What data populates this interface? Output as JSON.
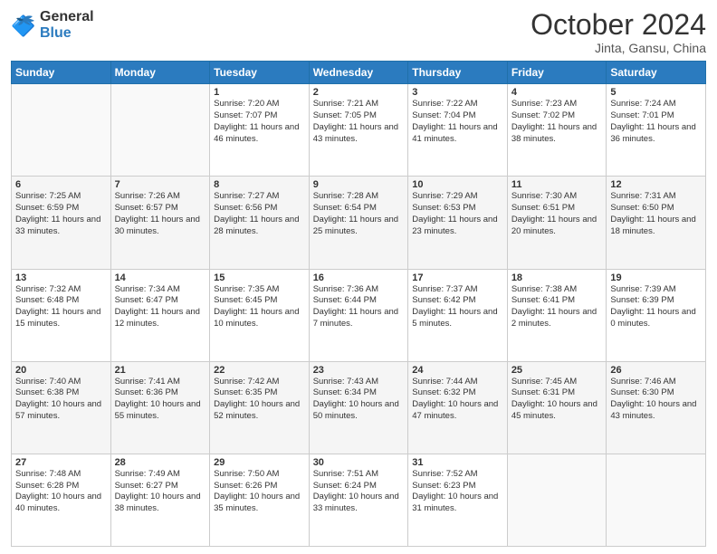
{
  "header": {
    "logo_line1": "General",
    "logo_line2": "Blue",
    "month": "October 2024",
    "location": "Jinta, Gansu, China"
  },
  "weekdays": [
    "Sunday",
    "Monday",
    "Tuesday",
    "Wednesday",
    "Thursday",
    "Friday",
    "Saturday"
  ],
  "weeks": [
    [
      {
        "day": "",
        "info": ""
      },
      {
        "day": "",
        "info": ""
      },
      {
        "day": "1",
        "info": "Sunrise: 7:20 AM\nSunset: 7:07 PM\nDaylight: 11 hours and 46 minutes."
      },
      {
        "day": "2",
        "info": "Sunrise: 7:21 AM\nSunset: 7:05 PM\nDaylight: 11 hours and 43 minutes."
      },
      {
        "day": "3",
        "info": "Sunrise: 7:22 AM\nSunset: 7:04 PM\nDaylight: 11 hours and 41 minutes."
      },
      {
        "day": "4",
        "info": "Sunrise: 7:23 AM\nSunset: 7:02 PM\nDaylight: 11 hours and 38 minutes."
      },
      {
        "day": "5",
        "info": "Sunrise: 7:24 AM\nSunset: 7:01 PM\nDaylight: 11 hours and 36 minutes."
      }
    ],
    [
      {
        "day": "6",
        "info": "Sunrise: 7:25 AM\nSunset: 6:59 PM\nDaylight: 11 hours and 33 minutes."
      },
      {
        "day": "7",
        "info": "Sunrise: 7:26 AM\nSunset: 6:57 PM\nDaylight: 11 hours and 30 minutes."
      },
      {
        "day": "8",
        "info": "Sunrise: 7:27 AM\nSunset: 6:56 PM\nDaylight: 11 hours and 28 minutes."
      },
      {
        "day": "9",
        "info": "Sunrise: 7:28 AM\nSunset: 6:54 PM\nDaylight: 11 hours and 25 minutes."
      },
      {
        "day": "10",
        "info": "Sunrise: 7:29 AM\nSunset: 6:53 PM\nDaylight: 11 hours and 23 minutes."
      },
      {
        "day": "11",
        "info": "Sunrise: 7:30 AM\nSunset: 6:51 PM\nDaylight: 11 hours and 20 minutes."
      },
      {
        "day": "12",
        "info": "Sunrise: 7:31 AM\nSunset: 6:50 PM\nDaylight: 11 hours and 18 minutes."
      }
    ],
    [
      {
        "day": "13",
        "info": "Sunrise: 7:32 AM\nSunset: 6:48 PM\nDaylight: 11 hours and 15 minutes."
      },
      {
        "day": "14",
        "info": "Sunrise: 7:34 AM\nSunset: 6:47 PM\nDaylight: 11 hours and 12 minutes."
      },
      {
        "day": "15",
        "info": "Sunrise: 7:35 AM\nSunset: 6:45 PM\nDaylight: 11 hours and 10 minutes."
      },
      {
        "day": "16",
        "info": "Sunrise: 7:36 AM\nSunset: 6:44 PM\nDaylight: 11 hours and 7 minutes."
      },
      {
        "day": "17",
        "info": "Sunrise: 7:37 AM\nSunset: 6:42 PM\nDaylight: 11 hours and 5 minutes."
      },
      {
        "day": "18",
        "info": "Sunrise: 7:38 AM\nSunset: 6:41 PM\nDaylight: 11 hours and 2 minutes."
      },
      {
        "day": "19",
        "info": "Sunrise: 7:39 AM\nSunset: 6:39 PM\nDaylight: 11 hours and 0 minutes."
      }
    ],
    [
      {
        "day": "20",
        "info": "Sunrise: 7:40 AM\nSunset: 6:38 PM\nDaylight: 10 hours and 57 minutes."
      },
      {
        "day": "21",
        "info": "Sunrise: 7:41 AM\nSunset: 6:36 PM\nDaylight: 10 hours and 55 minutes."
      },
      {
        "day": "22",
        "info": "Sunrise: 7:42 AM\nSunset: 6:35 PM\nDaylight: 10 hours and 52 minutes."
      },
      {
        "day": "23",
        "info": "Sunrise: 7:43 AM\nSunset: 6:34 PM\nDaylight: 10 hours and 50 minutes."
      },
      {
        "day": "24",
        "info": "Sunrise: 7:44 AM\nSunset: 6:32 PM\nDaylight: 10 hours and 47 minutes."
      },
      {
        "day": "25",
        "info": "Sunrise: 7:45 AM\nSunset: 6:31 PM\nDaylight: 10 hours and 45 minutes."
      },
      {
        "day": "26",
        "info": "Sunrise: 7:46 AM\nSunset: 6:30 PM\nDaylight: 10 hours and 43 minutes."
      }
    ],
    [
      {
        "day": "27",
        "info": "Sunrise: 7:48 AM\nSunset: 6:28 PM\nDaylight: 10 hours and 40 minutes."
      },
      {
        "day": "28",
        "info": "Sunrise: 7:49 AM\nSunset: 6:27 PM\nDaylight: 10 hours and 38 minutes."
      },
      {
        "day": "29",
        "info": "Sunrise: 7:50 AM\nSunset: 6:26 PM\nDaylight: 10 hours and 35 minutes."
      },
      {
        "day": "30",
        "info": "Sunrise: 7:51 AM\nSunset: 6:24 PM\nDaylight: 10 hours and 33 minutes."
      },
      {
        "day": "31",
        "info": "Sunrise: 7:52 AM\nSunset: 6:23 PM\nDaylight: 10 hours and 31 minutes."
      },
      {
        "day": "",
        "info": ""
      },
      {
        "day": "",
        "info": ""
      }
    ]
  ]
}
